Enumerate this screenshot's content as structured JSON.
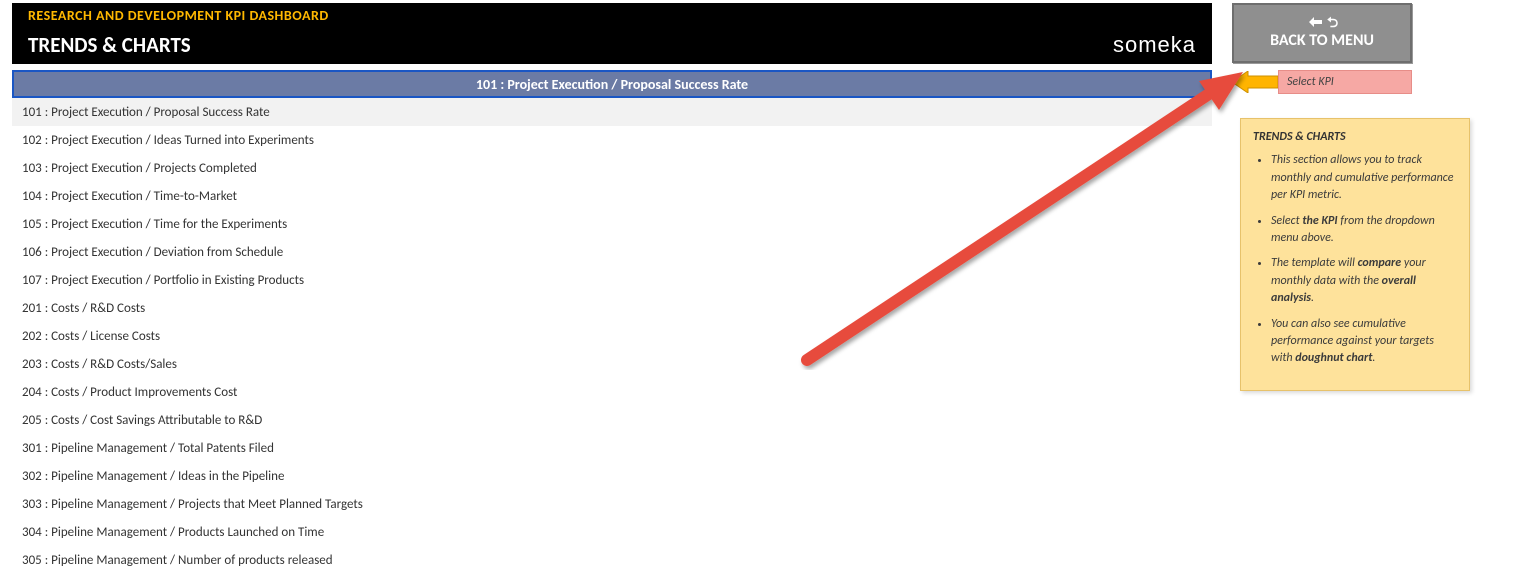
{
  "header": {
    "title": "RESEARCH AND DEVELOPMENT KPI DASHBOARD",
    "subtitle": "TRENDS & CHARTS",
    "logo_text": "someka"
  },
  "dropdown": {
    "selected": "101 : Project Execution / Proposal Success Rate",
    "items": [
      "101 : Project Execution / Proposal Success Rate",
      "102 : Project Execution / Ideas Turned into Experiments",
      "103 : Project Execution / Projects Completed",
      "104 : Project Execution / Time-to-Market",
      "105 : Project Execution / Time for the Experiments",
      "106 : Project Execution / Deviation from Schedule",
      "107 : Project Execution / Portfolio in Existing Products",
      "201 : Costs / R&D Costs",
      "202 : Costs / License Costs",
      "203 : Costs / R&D Costs/Sales",
      "204 : Costs / Product Improvements Cost",
      "205 : Costs / Cost Savings Attributable to R&D",
      "301 : Pipeline Management / Total Patents Filed",
      "302 : Pipeline Management / Ideas in the Pipeline",
      "303 : Pipeline Management / Projects that Meet Planned Targets",
      "304 : Pipeline Management / Products Launched on Time",
      "305 : Pipeline Management / Number of products released"
    ]
  },
  "back_button": {
    "label": "BACK TO MENU"
  },
  "select_kpi": {
    "label": "Select KPI"
  },
  "info": {
    "title": "TRENDS & CHARTS",
    "b1_a": "This section allows you to track monthly and cumulative performance per KPI metric.",
    "b2_a": "Select ",
    "b2_b": "the KPI",
    "b2_c": " from the dropdown menu above.",
    "b3_a": "The template will ",
    "b3_b": "compare",
    "b3_c": " your monthly data with the ",
    "b3_d": "overall analysis",
    "b3_e": ".",
    "b4_a": "You can also see cumulative performance against your targets with ",
    "b4_b": "doughnut chart",
    "b4_c": "."
  }
}
